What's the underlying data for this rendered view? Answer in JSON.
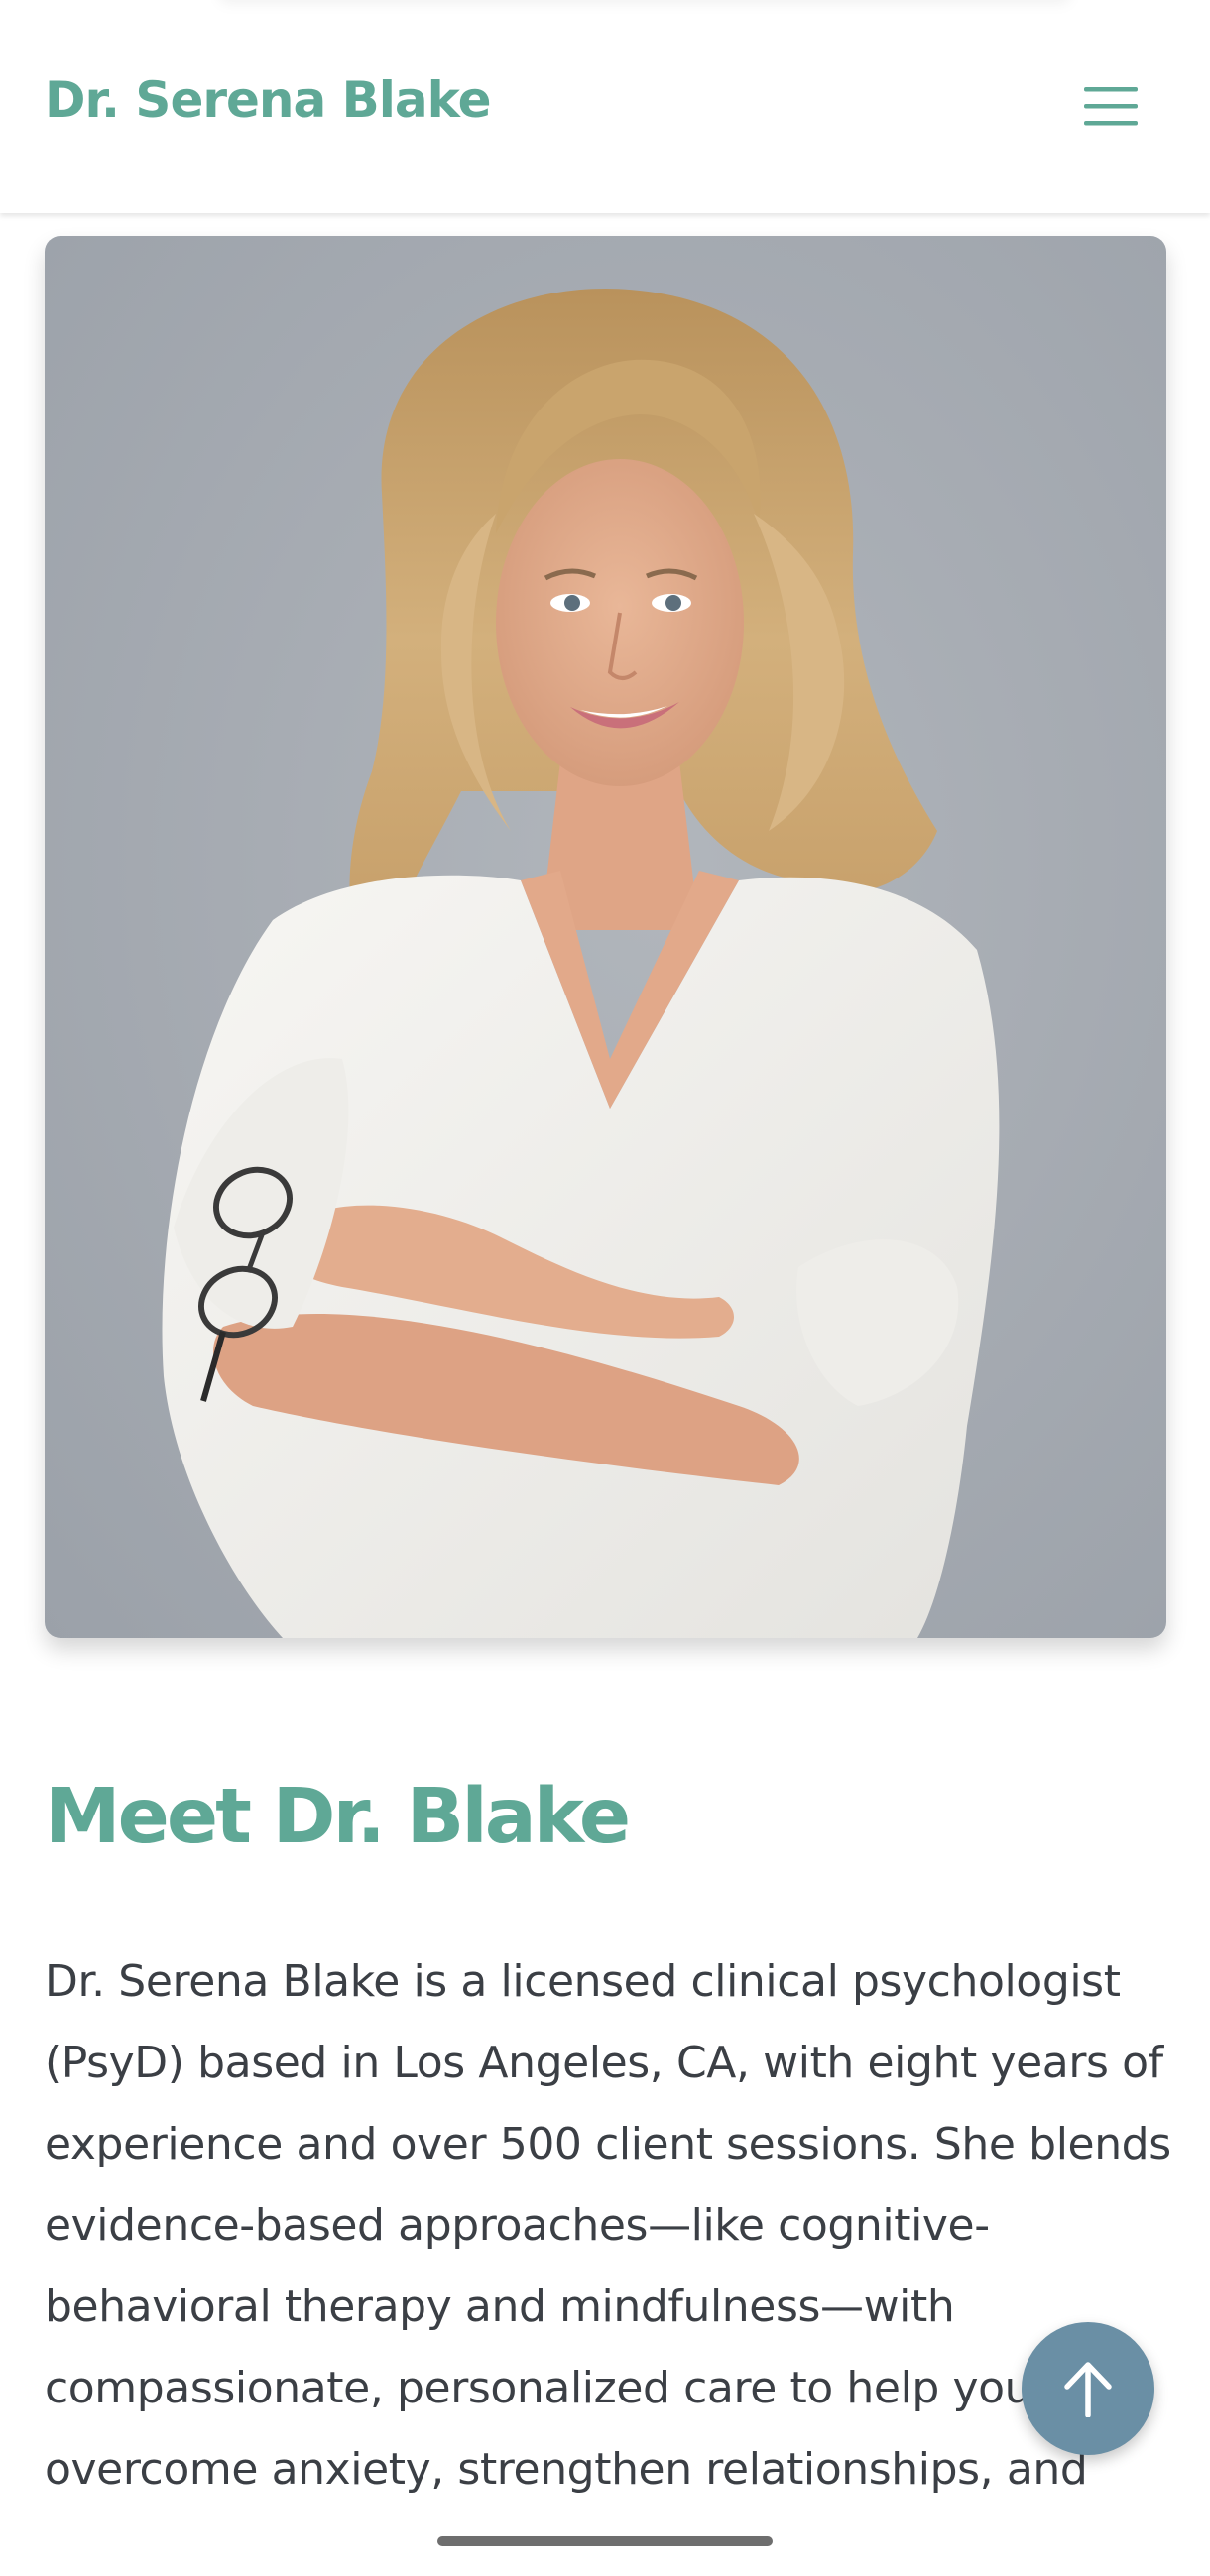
{
  "header": {
    "site_title": "Dr. Serena Blake",
    "menu_icon": "hamburger-menu-icon"
  },
  "hero": {
    "image_subject": "portrait-photo"
  },
  "about": {
    "heading": "Meet Dr. Blake",
    "bio": "Dr. Serena Blake is a licensed clinical psychologist (PsyD) based in Los Angeles, CA, with eight years of experience and over 500 client sessions. She blends evidence-based approaches—like cognitive-behavioral therapy and mindfulness—with compassionate, personalized care to help you overcome anxiety, strengthen relationships, and"
  },
  "back_to_top": {
    "icon": "arrow-up-icon"
  },
  "colors": {
    "accent": "#5fa896",
    "text": "#3b3f45",
    "fab": "#6a8fa5"
  }
}
